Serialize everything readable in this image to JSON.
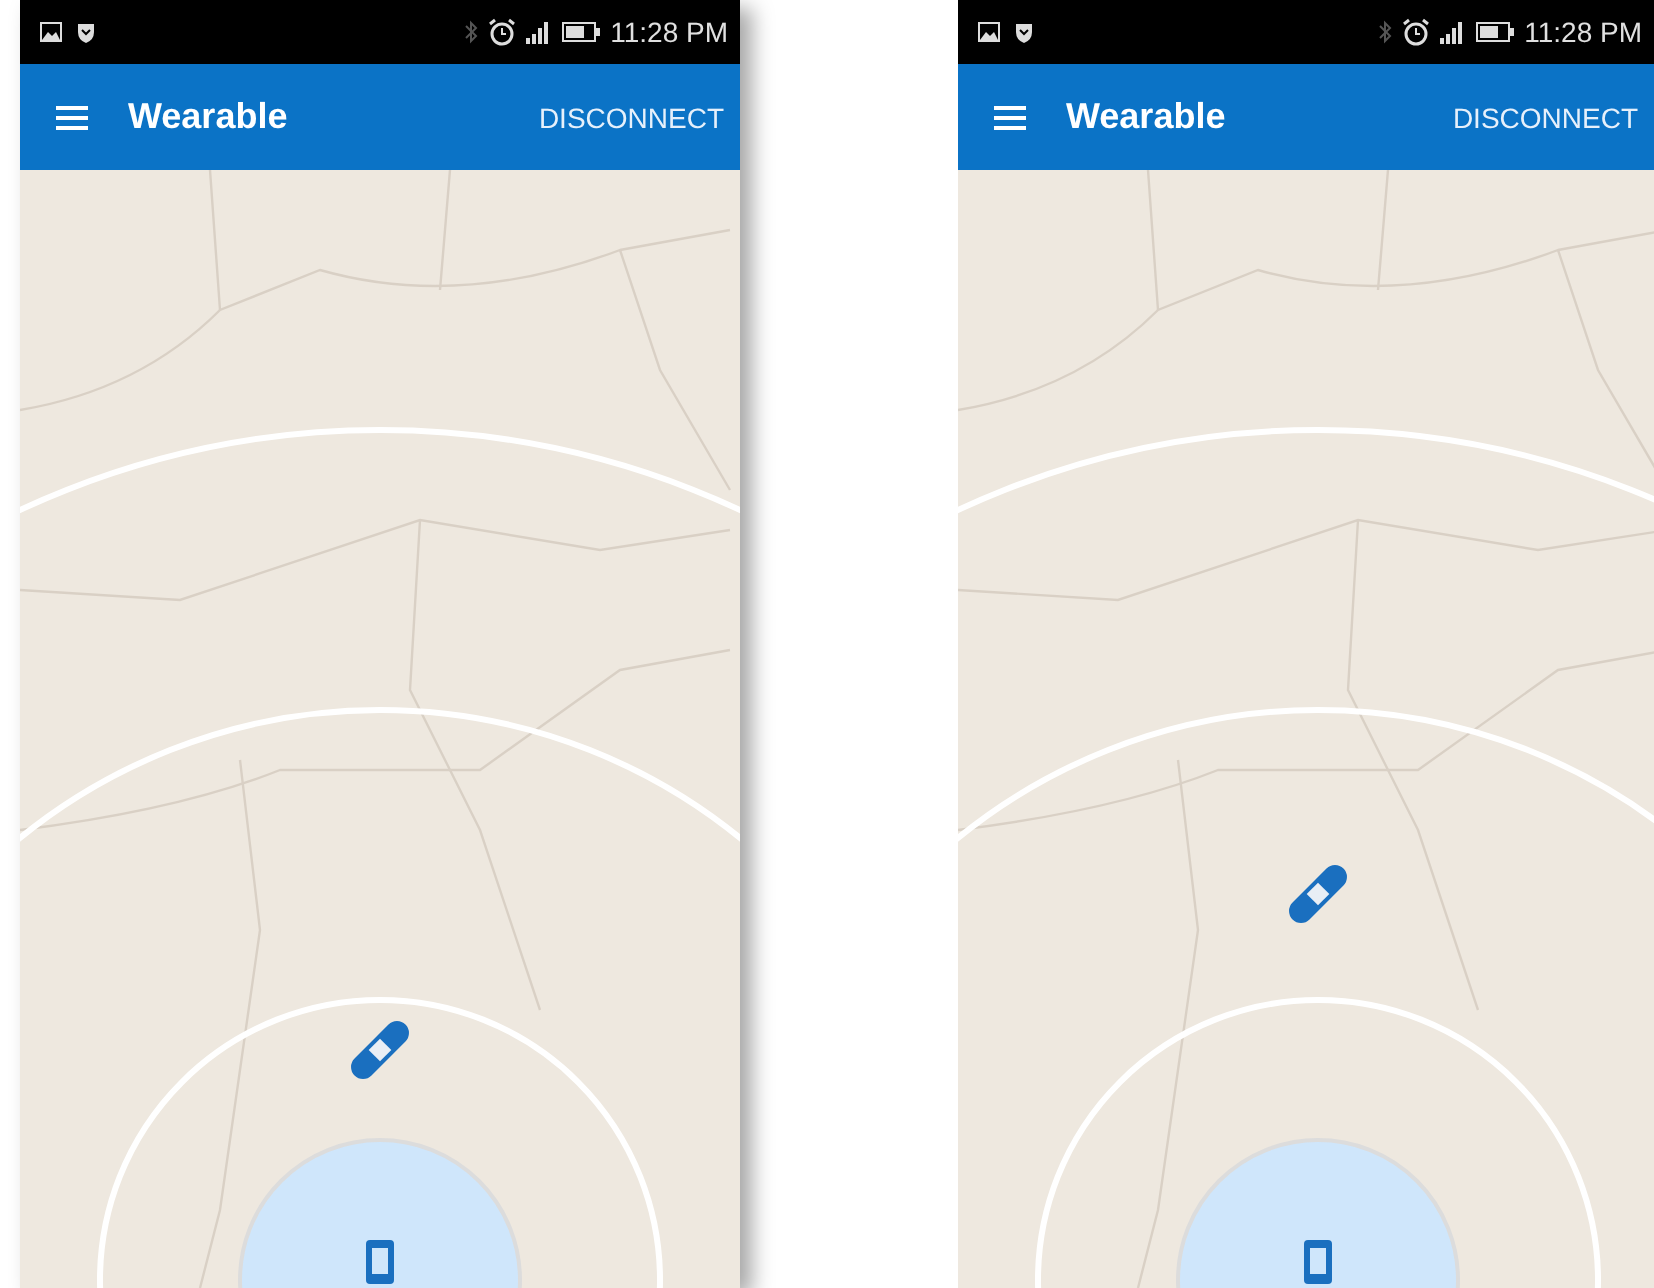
{
  "phones": [
    {
      "status_bar": {
        "time": "11:28 PM"
      },
      "app_bar": {
        "title": "Wearable",
        "action": "DISCONNECT"
      },
      "kind": "near"
    },
    {
      "status_bar": {
        "time": "11:28 PM"
      },
      "app_bar": {
        "title": "Wearable",
        "action": "DISCONNECT"
      },
      "kind": "far"
    }
  ]
}
